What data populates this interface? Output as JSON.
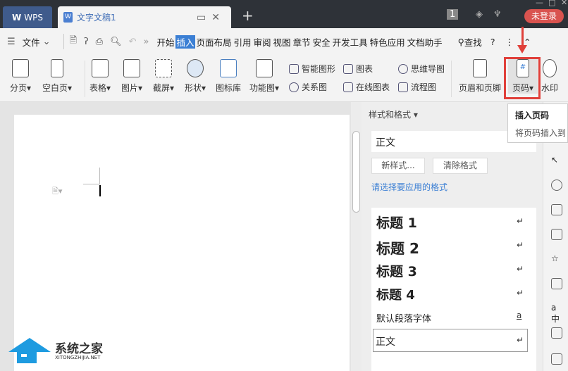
{
  "titlebar": {
    "app_tab": "WPS",
    "doc_tab": "文字文稿1",
    "new_tab": "+",
    "badge": "1",
    "login": "未登录"
  },
  "toolbar": {
    "file": "文件",
    "menus": [
      "开始",
      "插入",
      "页面布局",
      "引用",
      "审阅",
      "视图",
      "章节",
      "安全",
      "开发工具",
      "特色应用",
      "文档助手"
    ],
    "active_menu": "插入",
    "search": "查找",
    "help": "?"
  },
  "ribbon": {
    "items": [
      "分页",
      "空白页",
      "表格",
      "图片",
      "截屏",
      "形状",
      "图标库",
      "功能图",
      "页眉和页脚",
      "页码",
      "水印"
    ],
    "small": [
      "智能图形",
      "关系图",
      "图表",
      "在线图表",
      "思维导图",
      "流程图"
    ]
  },
  "tooltip": {
    "title": "插入页码",
    "desc": "将页码插入到"
  },
  "panel": {
    "title": "样式和格式",
    "current_style": "正文",
    "new_style": "新样式...",
    "clear_format": "清除格式",
    "choose_label": "请选择要应用的格式",
    "styles": [
      "标题  1",
      "标题  2",
      "标题  3",
      "标题  4",
      "默认段落字体",
      "正文"
    ],
    "marks": [
      "↵",
      "↵",
      "↵",
      "↵",
      "a",
      "↵"
    ]
  },
  "watermark": {
    "name": "系统之家",
    "url": "XITONGZHIJIA.NET"
  },
  "colors": {
    "accent": "#3b7fd4",
    "highlight": "#e0403a",
    "login": "#d9534f"
  }
}
